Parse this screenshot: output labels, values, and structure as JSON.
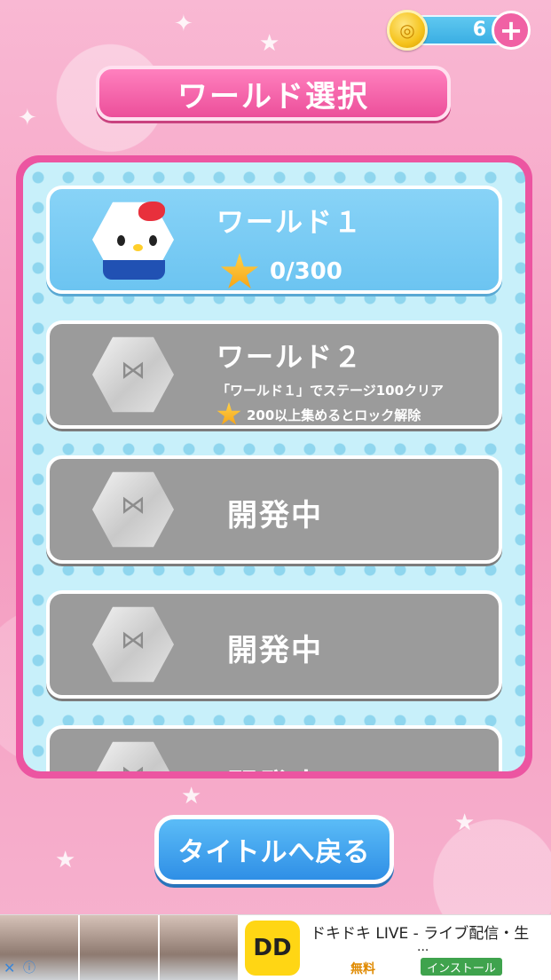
{
  "coins": {
    "count": "6",
    "plus_label": "+",
    "coin_symbol": "◎"
  },
  "header": {
    "title": "ワールド選択"
  },
  "worlds": [
    {
      "title": "ワールド１",
      "progress": "0/300",
      "state": "active"
    },
    {
      "title": "ワールド２",
      "requirement_1": "「ワールド１」でステージ100クリア",
      "requirement_2": "200以上集めるとロック解除",
      "state": "locked"
    },
    {
      "title": "開発中",
      "state": "dev"
    },
    {
      "title": "開発中",
      "state": "dev"
    },
    {
      "title": "開発中",
      "state": "dev"
    }
  ],
  "back_button": {
    "label": "タイトルへ戻る"
  },
  "ad": {
    "title": "ドキドキ LIVE - ライブ配信・生",
    "ellipsis": "...",
    "free_label": "無料",
    "install_label": "インストール",
    "logo_text": "DD",
    "close_icon": "✕",
    "info_icon": "ⓘ"
  },
  "colors": {
    "accent_pink": "#ec4f9a",
    "active_blue": "#6cc4f1",
    "locked_gray": "#9b9b9b",
    "button_blue": "#2f8fe6"
  }
}
